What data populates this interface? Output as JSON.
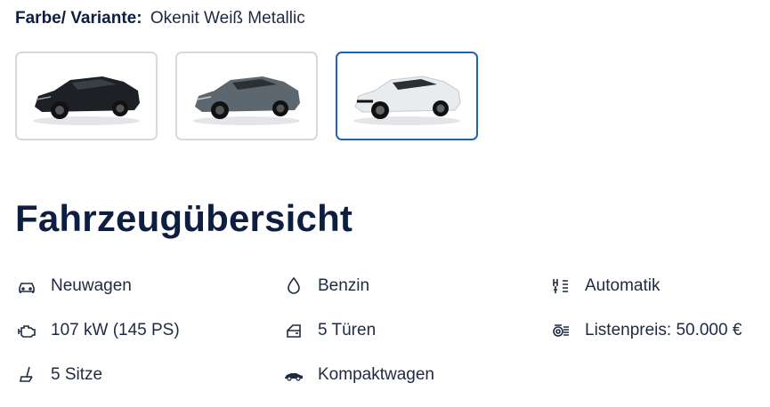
{
  "variant": {
    "label": "Farbe/ Variante:",
    "value": "Okenit Weiß Metallic"
  },
  "swatches": [
    {
      "color_name": "black",
      "body": "#1d2024",
      "accent": "#3a3f46",
      "selected": false
    },
    {
      "color_name": "grey",
      "body": "#5d676f",
      "accent": "#7c868e",
      "selected": false
    },
    {
      "color_name": "white",
      "body": "#e9ecef",
      "accent": "#ffffff",
      "selected": true
    }
  ],
  "overview": {
    "title": "Fahrzeugübersicht",
    "features": [
      {
        "icon": "car-icon",
        "text": "Neuwagen"
      },
      {
        "icon": "fuel-drop-icon",
        "text": "Benzin"
      },
      {
        "icon": "gearbox-icon",
        "text": "Automatik"
      },
      {
        "icon": "engine-icon",
        "text": "107 kW (145 PS)"
      },
      {
        "icon": "door-icon",
        "text": "5 Türen"
      },
      {
        "icon": "price-tag-icon",
        "text": "Listenpreis: 50.000 €"
      },
      {
        "icon": "seat-icon",
        "text": "5 Sitze"
      },
      {
        "icon": "compact-car-icon",
        "text": "Kompaktwagen"
      }
    ]
  },
  "colors": {
    "navy": "#0d1e41",
    "selected_border": "#1f63b5",
    "border": "#d6d9de"
  }
}
